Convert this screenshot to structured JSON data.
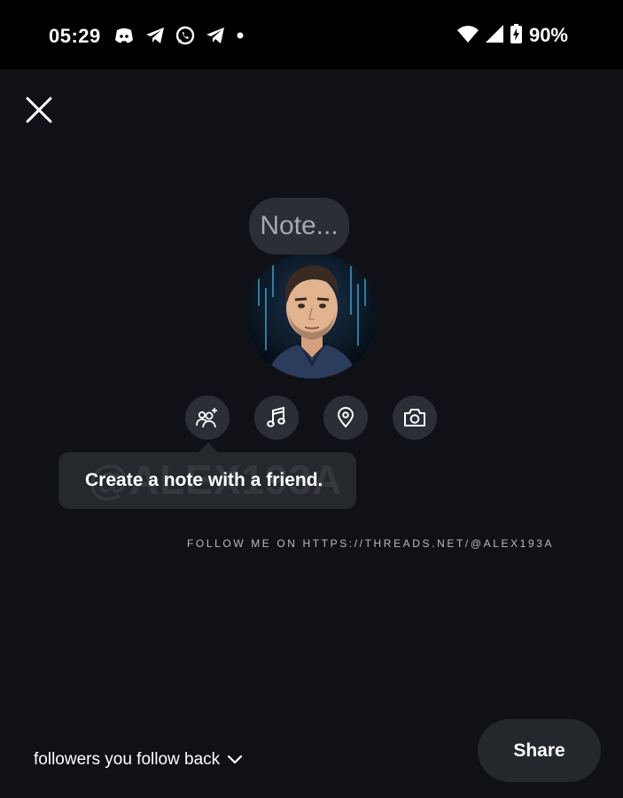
{
  "status_bar": {
    "time": "05:29",
    "notification_icons": [
      "discord-icon",
      "telegram-icon",
      "whatsapp-icon",
      "telegram-icon",
      "dot-icon"
    ],
    "battery": "90%",
    "system_icons": [
      "wifi-icon",
      "signal-icon",
      "battery-charging-icon"
    ]
  },
  "header": {
    "close_icon": "close-icon"
  },
  "note": {
    "placeholder": "Note..."
  },
  "actions": [
    {
      "name": "add-friend",
      "icon": "people-add-icon"
    },
    {
      "name": "music",
      "icon": "music-note-icon"
    },
    {
      "name": "location",
      "icon": "location-pin-icon"
    },
    {
      "name": "camera",
      "icon": "camera-icon"
    }
  ],
  "tooltip": {
    "text": "Create a note with a friend."
  },
  "watermark": {
    "text": "@ALEX193A"
  },
  "follow_banner": {
    "text": "FOLLOW ME ON HTTPS://THREADS.NET/@ALEX193A"
  },
  "footer": {
    "audience": "followers you follow back",
    "share_label": "Share"
  },
  "colors": {
    "background": "#0f1116",
    "button_bg": "#2b2e34",
    "tooltip_bg": "#25282d",
    "placeholder": "#a6a9ae"
  }
}
